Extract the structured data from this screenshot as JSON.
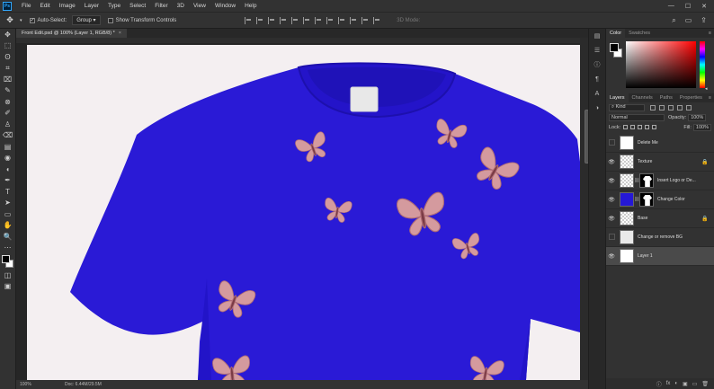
{
  "menubar": {
    "logo": "Ps",
    "items": [
      "File",
      "Edit",
      "Image",
      "Layer",
      "Type",
      "Select",
      "Filter",
      "3D",
      "View",
      "Window",
      "Help"
    ],
    "window_controls": [
      "—",
      "☐",
      "✕"
    ]
  },
  "optionsbar": {
    "auto_select_label": "Auto-Select:",
    "auto_select_value": "Group",
    "show_transform_label": "Show Transform Controls",
    "mode_3d_label": "3D Mode:"
  },
  "document": {
    "tab_title": "Front Edit.psd @ 100% (Layer 1, RGB/8) *",
    "tab_close": "×",
    "zoom": "100%",
    "doc_info": "Doc: 6.44M/29.5M",
    "shirt_color": "#2a1ad6",
    "butterfly_color": "#d49a9e"
  },
  "color_panel": {
    "tabs": [
      "Color",
      "Swatches"
    ]
  },
  "layers_panel": {
    "tabs": [
      "Layers",
      "Channels",
      "Paths",
      "Properties"
    ],
    "kind_label": "⌕ Kind",
    "blend_mode": "Normal",
    "opacity_label": "Opacity:",
    "opacity_value": "100%",
    "lock_label": "Lock:",
    "fill_label": "Fill:",
    "fill_value": "100%",
    "layers": [
      {
        "name": "Delete Me",
        "visible": false,
        "thumb": "white",
        "mask": false,
        "locked": false,
        "selected": false
      },
      {
        "name": "Texture",
        "visible": true,
        "thumb": "checker",
        "mask": false,
        "locked": true,
        "selected": false
      },
      {
        "name": "Insert Logo or De...",
        "visible": true,
        "thumb": "checker",
        "mask": true,
        "locked": false,
        "selected": false
      },
      {
        "name": "Change Color",
        "visible": true,
        "thumb": "blue",
        "mask": true,
        "locked": false,
        "selected": false
      },
      {
        "name": "Base",
        "visible": true,
        "thumb": "checker",
        "mask": false,
        "locked": true,
        "selected": false
      },
      {
        "name": "Change or remove BG",
        "visible": false,
        "thumb": "grayish",
        "mask": false,
        "locked": false,
        "selected": false
      },
      {
        "name": "Layer 1",
        "visible": true,
        "thumb": "white",
        "mask": false,
        "locked": false,
        "selected": true
      }
    ],
    "footer_icons": [
      "ⓘ",
      "fx",
      "◐",
      "▣",
      "▭",
      "🗑"
    ]
  },
  "toolbar": {
    "tools": [
      "✥",
      "⬚",
      "ʘ",
      "⌗",
      "⌧",
      "✎",
      "⊗",
      "✐",
      "♙",
      "⌫",
      "▤",
      "◉",
      "◖",
      "✒",
      "T",
      "➤",
      "▭",
      "✋",
      "🔍",
      "⋯"
    ]
  }
}
